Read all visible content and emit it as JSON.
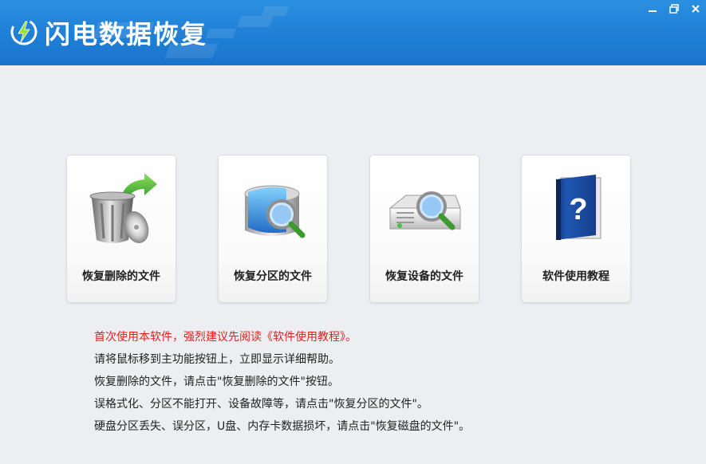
{
  "app": {
    "title": "闪电数据恢复",
    "accent_color": "#1f7fd6",
    "window_controls": [
      "minimize-icon",
      "restore-icon",
      "close-icon"
    ]
  },
  "features": [
    {
      "label": "恢复删除的文件",
      "icon": "trash-restore-icon"
    },
    {
      "label": "恢复分区的文件",
      "icon": "disk-search-icon"
    },
    {
      "label": "恢复设备的文件",
      "icon": "device-search-icon"
    },
    {
      "label": "软件使用教程",
      "icon": "help-book-icon"
    }
  ],
  "help": {
    "warning": "首次使用本软件，强烈建议先阅读《软件使用教程》。",
    "lines": [
      "请将鼠标移到主功能按钮上，立即显示详细帮助。",
      "恢复删除的文件，请点击\"恢复删除的文件\"按钮。",
      "误格式化、分区不能打开、设备故障等，请点击\"恢复分区的文件\"。",
      "硬盘分区丢失、误分区，U盘、内存卡数据损坏，请点击\"恢复磁盘的文件\"。"
    ],
    "warning_color": "#e02020"
  }
}
